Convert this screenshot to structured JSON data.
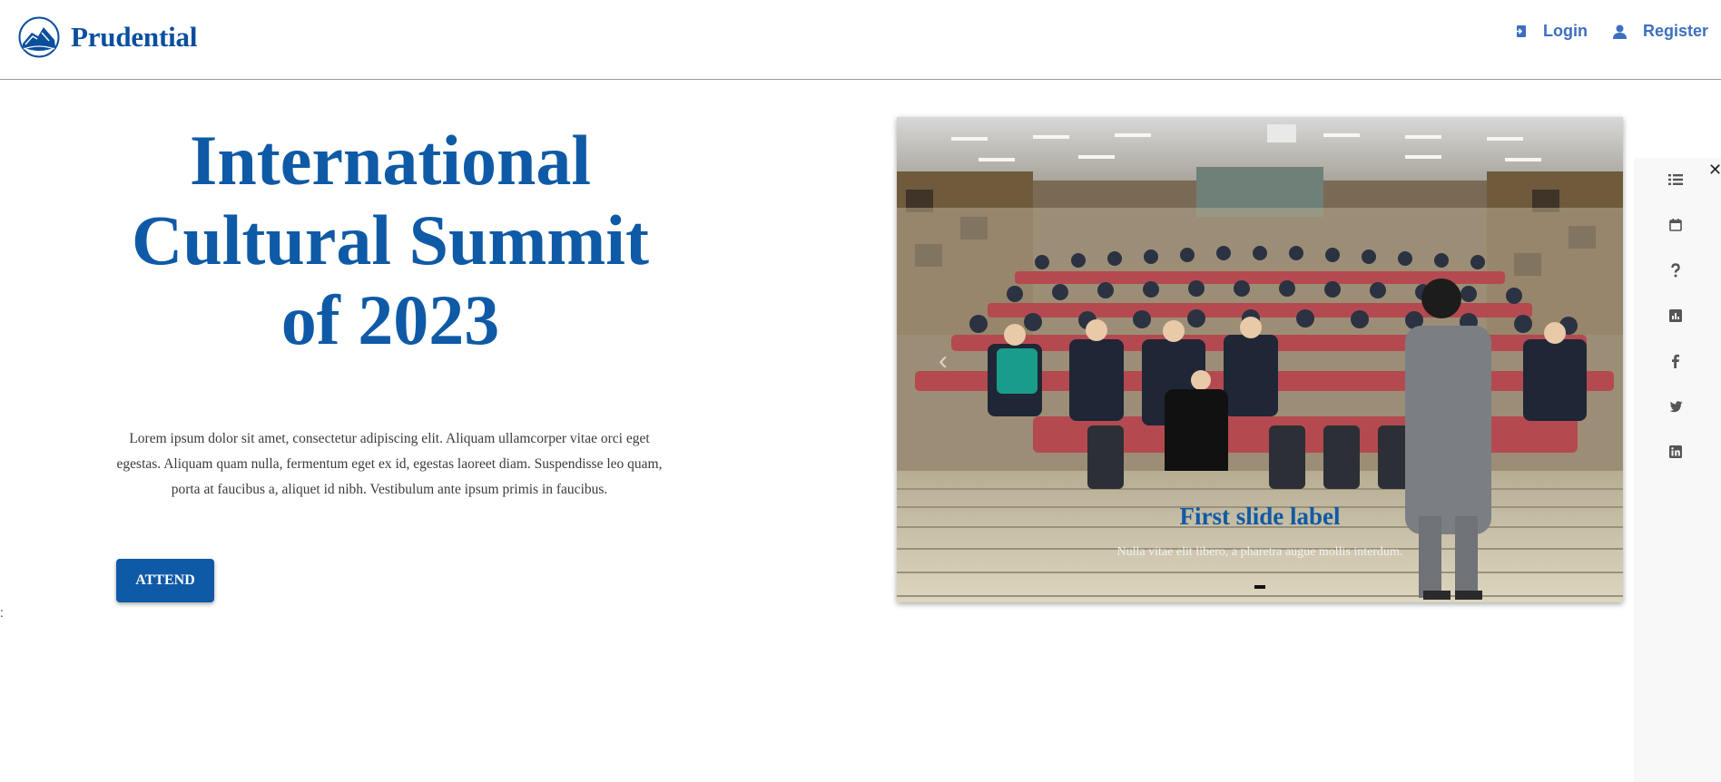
{
  "header": {
    "logo_text": "Prudential",
    "login_label": "Login",
    "register_label": "Register"
  },
  "hero": {
    "title": "International Cultural Summit of 2023",
    "description": "Lorem ipsum dolor sit amet, consectetur adipiscing elit. Aliquam ullamcorper vitae orci eget egestas. Aliquam quam nulla, fermentum eget ex id, egestas laoreet diam. Suspendisse leo quam, porta at faucibus a, aliquet id nibh. Vestibulum ante ipsum primis in faucibus.",
    "attend_label": "ATTEND"
  },
  "carousel": {
    "slide_label": "First slide label",
    "slide_caption": "Nulla vitae elit libero, a pharetra augue mollis interdum.",
    "active_index": 1,
    "slide_count": 1
  },
  "side_panel": {
    "icons": [
      "list-icon",
      "calendar-icon",
      "help-icon",
      "chart-icon",
      "facebook-icon",
      "twitter-icon",
      "linkedin-icon"
    ]
  },
  "colors": {
    "brand_blue": "#0f5aa6",
    "nav_blue": "#3d6fc0",
    "panel_bg": "#f8f8f8"
  }
}
